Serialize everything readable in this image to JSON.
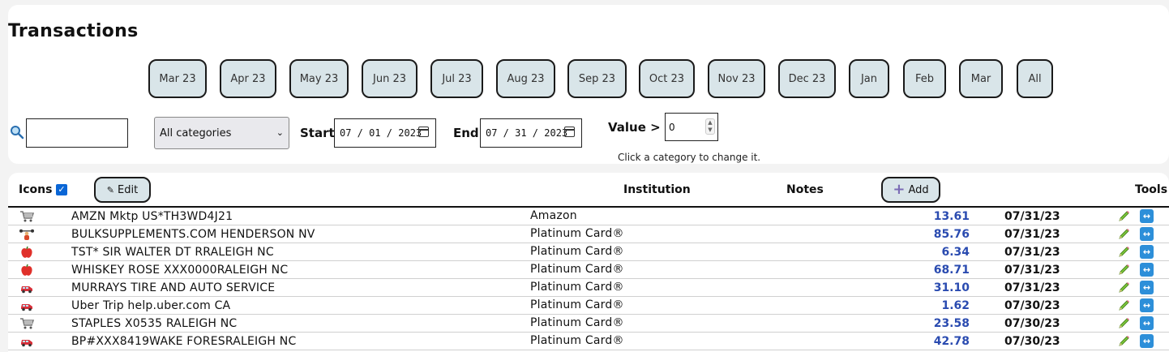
{
  "page": {
    "title": "Transactions"
  },
  "months": [
    "Mar 23",
    "Apr 23",
    "May 23",
    "Jun 23",
    "Jul 23",
    "Aug 23",
    "Sep 23",
    "Oct 23",
    "Nov 23",
    "Dec 23",
    "Jan",
    "Feb",
    "Mar",
    "All"
  ],
  "filters": {
    "search_value": "",
    "category_selected": "All categories",
    "start_label": "Start:",
    "start_value": "07 / 01 / 2023",
    "end_label": "End:",
    "end_value": "07 / 31 / 2023",
    "value_label": "Value >",
    "value_value": "0",
    "hint": "Click a category to change it."
  },
  "table": {
    "icons_label": "Icons",
    "edit_label": "Edit",
    "institution_label": "Institution",
    "notes_label": "Notes",
    "add_label": "Add",
    "tools_label": "Tools",
    "rows": [
      {
        "icon": "cart-icon",
        "description": "AMZN Mktp US*TH3WD4J21",
        "institution": "Amazon",
        "amount": "13.61",
        "date": "07/31/23"
      },
      {
        "icon": "weightlifter-icon",
        "description": "BULKSUPPLEMENTS.COM HENDERSON NV",
        "institution": "Platinum Card®",
        "amount": "85.76",
        "date": "07/31/23"
      },
      {
        "icon": "apple-icon",
        "description": "TST* SIR WALTER DT RRALEIGH NC",
        "institution": "Platinum Card®",
        "amount": "6.34",
        "date": "07/31/23"
      },
      {
        "icon": "apple-icon",
        "description": "WHISKEY ROSE XXX0000RALEIGH NC",
        "institution": "Platinum Card®",
        "amount": "68.71",
        "date": "07/31/23"
      },
      {
        "icon": "car-icon",
        "description": "MURRAYS TIRE AND AUTO SERVICE",
        "institution": "Platinum Card®",
        "amount": "31.10",
        "date": "07/31/23"
      },
      {
        "icon": "car-icon",
        "description": "Uber Trip help.uber.com CA",
        "institution": "Platinum Card®",
        "amount": "1.62",
        "date": "07/30/23"
      },
      {
        "icon": "cart-icon",
        "description": "STAPLES X0535 RALEIGH NC",
        "institution": "Platinum Card®",
        "amount": "23.58",
        "date": "07/30/23"
      },
      {
        "icon": "car-icon",
        "description": "BP#XXX8419WAKE FORESRALEIGH NC",
        "institution": "Platinum Card®",
        "amount": "42.78",
        "date": "07/30/23"
      }
    ]
  },
  "colors": {
    "button_bg": "#d9e5e9",
    "amount": "#2a4bb0",
    "swap_bg": "#2d8fd9",
    "checkbox": "#0a66d6"
  }
}
